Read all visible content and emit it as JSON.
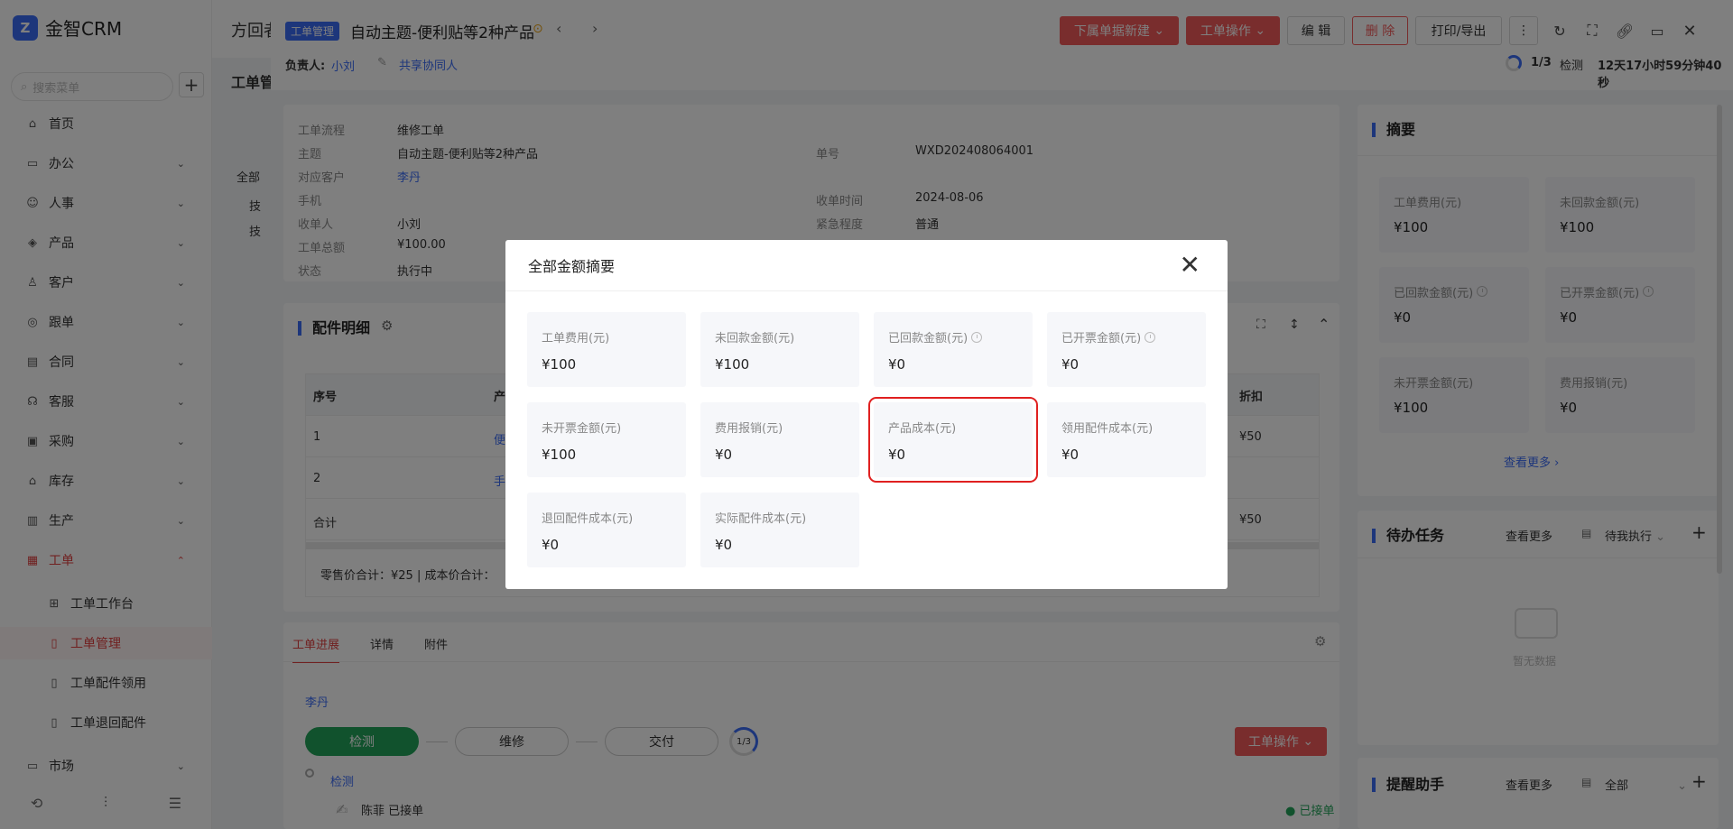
{
  "app": {
    "name": "金智CRM",
    "logo_letter": "Z"
  },
  "sidebar": {
    "search_placeholder": "搜索菜单",
    "items": [
      {
        "label": "首页",
        "icon": "home-icon"
      },
      {
        "label": "办公",
        "icon": "briefcase-icon"
      },
      {
        "label": "人事",
        "icon": "people-icon"
      },
      {
        "label": "产品",
        "icon": "box-icon"
      },
      {
        "label": "客户",
        "icon": "user-icon"
      },
      {
        "label": "跟单",
        "icon": "target-icon"
      },
      {
        "label": "合同",
        "icon": "contract-icon"
      },
      {
        "label": "客服",
        "icon": "headset-icon"
      },
      {
        "label": "采购",
        "icon": "cart-icon"
      },
      {
        "label": "库存",
        "icon": "warehouse-icon"
      },
      {
        "label": "生产",
        "icon": "factory-icon"
      },
      {
        "label": "工单",
        "icon": "ticket-icon"
      }
    ],
    "sub_items": [
      {
        "label": "工单工作台"
      },
      {
        "label": "工单管理"
      },
      {
        "label": "工单配件领用"
      },
      {
        "label": "工单退回配件"
      }
    ],
    "market": "市场"
  },
  "page": {
    "tab_title": "方回者",
    "sub_title": "工单管",
    "tree": [
      "全部",
      "技",
      "技"
    ]
  },
  "detail": {
    "tag": "工单管理",
    "title": "自动主题-便利贴等2种产品",
    "owner_label": "负责人:",
    "owner": "小刘",
    "share": "共享协同人",
    "buttons": {
      "sub_new": "下属单据新建",
      "ops": "工单操作",
      "edit": "编 辑",
      "delete": "删 除",
      "print": "打印/导出"
    },
    "progress": "1/3",
    "progress_stage": "检测",
    "timer": "12天17小时59分钟40秒",
    "fields": [
      {
        "label": "工单流程",
        "value": "维修工单"
      },
      {
        "label": "主题",
        "value": "自动主题-便利贴等2种产品"
      },
      {
        "label": "对应客户",
        "value": "李丹"
      },
      {
        "label": "手机",
        "value": ""
      },
      {
        "label": "收单人",
        "value": "小刘"
      },
      {
        "label": "工单总额",
        "value": "¥100.00"
      },
      {
        "label": "状态",
        "value": "执行中"
      }
    ],
    "fields_right": [
      {
        "label": "单号",
        "value": "WXD202408064001"
      },
      {
        "label": "收单时间",
        "value": "2024-08-06"
      },
      {
        "label": "紧急程度",
        "value": "普通"
      }
    ],
    "parts": {
      "title": "配件明细",
      "headers": [
        "序号",
        "产",
        "折扣"
      ],
      "rows": [
        [
          "1",
          "便",
          "¥50"
        ],
        [
          "2",
          "手",
          ""
        ],
        [
          "合计",
          "",
          "¥50"
        ]
      ],
      "footer": "零售价合计：¥25 |   成本价合计："
    },
    "tabs": [
      "工单进展",
      "详情",
      "附件"
    ],
    "customer": "李丹",
    "stages": [
      "检测",
      "维修",
      "交付"
    ],
    "stage_count": "1/3",
    "ops_btn": "工单操作",
    "timeline_item": "检测",
    "timeline_user": "陈菲 已接单",
    "timeline_status": "● 已接单"
  },
  "right": {
    "summary_title": "摘要",
    "summary": [
      {
        "label": "工单费用(元)",
        "value": "¥100"
      },
      {
        "label": "未回款金额(元)",
        "value": "¥100"
      },
      {
        "label": "已回款金额(元)",
        "value": "¥0"
      },
      {
        "label": "已开票金额(元)",
        "value": "¥0"
      },
      {
        "label": "未开票金额(元)",
        "value": "¥100"
      },
      {
        "label": "费用报销(元)",
        "value": "¥0"
      }
    ],
    "more": "查看更多",
    "todo_title": "待办任务",
    "todo_more": "查看更多",
    "todo_filter": "待我执行",
    "empty": "暂无数据",
    "remind_title": "提醒助手",
    "remind_more": "查看更多",
    "remind_filter": "全部"
  },
  "modal": {
    "title": "全部金额摘要",
    "cards": [
      {
        "label": "工单费用(元)",
        "value": "¥100"
      },
      {
        "label": "未回款金额(元)",
        "value": "¥100"
      },
      {
        "label": "已回款金额(元)",
        "value": "¥0"
      },
      {
        "label": "已开票金额(元)",
        "value": "¥0"
      },
      {
        "label": "未开票金额(元)",
        "value": "¥100"
      },
      {
        "label": "费用报销(元)",
        "value": "¥0"
      },
      {
        "label": "产品成本(元)",
        "value": "¥0"
      },
      {
        "label": "领用配件成本(元)",
        "value": "¥0"
      },
      {
        "label": "退回配件成本(元)",
        "value": "¥0"
      },
      {
        "label": "实际配件成本(元)",
        "value": "¥0"
      }
    ]
  },
  "colors": {
    "accent": "#3b6cf6",
    "danger": "#f25a5a",
    "highlight": "#e02020"
  }
}
